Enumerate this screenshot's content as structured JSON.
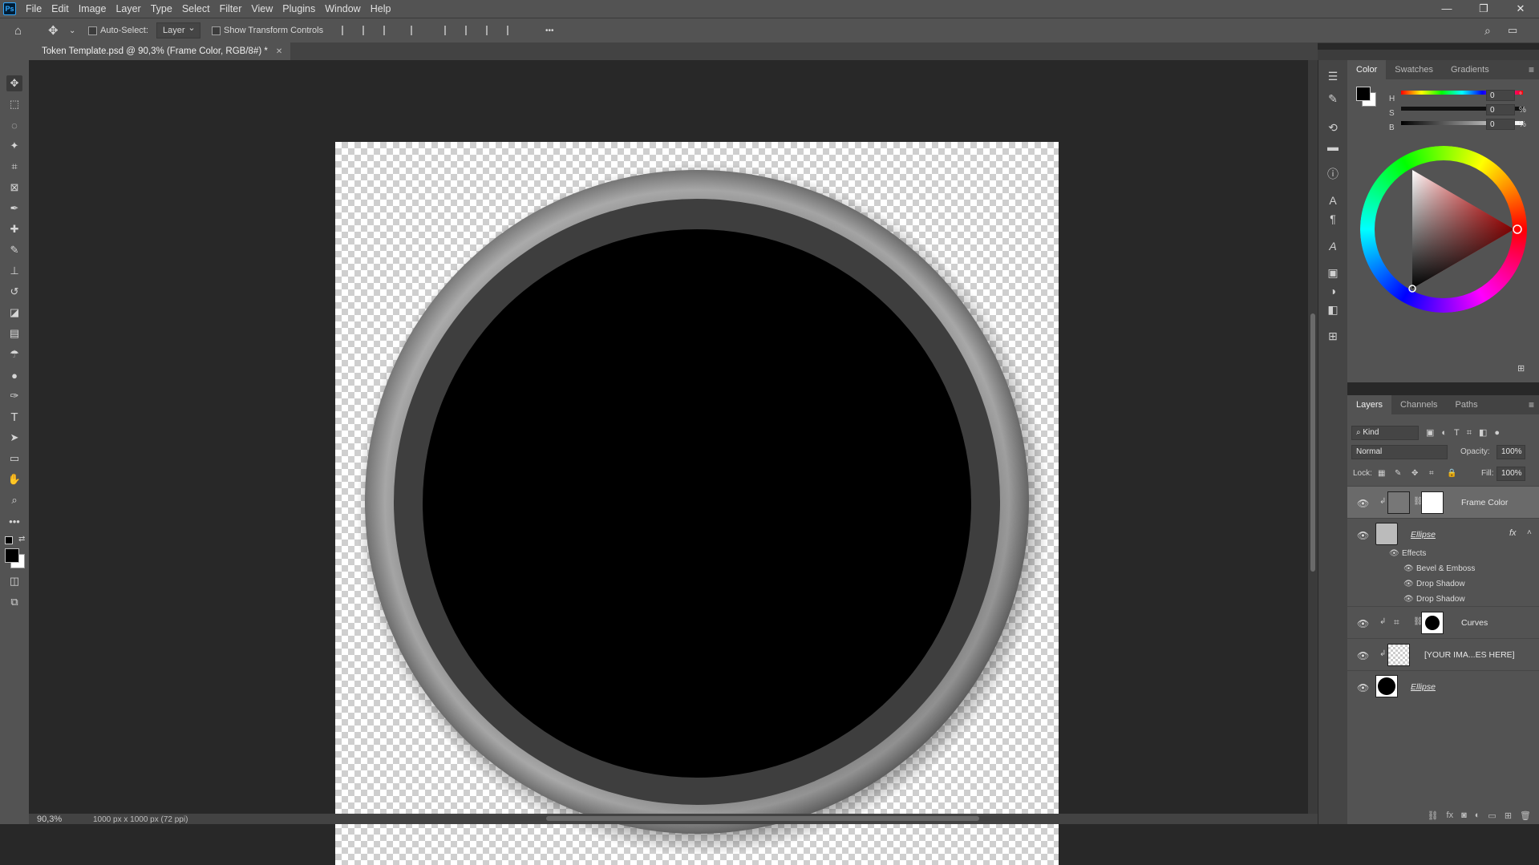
{
  "app": {
    "logo": "Ps"
  },
  "menu": [
    "File",
    "Edit",
    "Image",
    "Layer",
    "Type",
    "Select",
    "Filter",
    "View",
    "Plugins",
    "Window",
    "Help"
  ],
  "window_controls": {
    "minimize": "—",
    "restore": "❐",
    "close": "✕"
  },
  "options": {
    "auto_select_label": "Auto-Select:",
    "auto_select_value": "Layer",
    "transform_label": "Show Transform Controls",
    "more": "•••"
  },
  "document": {
    "tab_title": "Token Template.psd @ 90,3% (Frame Color, RGB/8#) *",
    "close": "✕"
  },
  "status": {
    "zoom": "90,3%",
    "size": "1000 px x 1000 px (72 ppi)"
  },
  "color_panel": {
    "tabs": [
      "Color",
      "Swatches",
      "Gradients"
    ],
    "sliders": [
      {
        "label": "H",
        "value": "0",
        "unit": "°"
      },
      {
        "label": "S",
        "value": "0",
        "unit": "%"
      },
      {
        "label": "B",
        "value": "0",
        "unit": "%"
      }
    ],
    "foreground": "#000000",
    "background": "#ffffff"
  },
  "layers_panel": {
    "tabs": [
      "Layers",
      "Channels",
      "Paths"
    ],
    "filter_kind": "Kind",
    "blend_mode": "Normal",
    "opacity_label": "Opacity:",
    "opacity_value": "100%",
    "lock_label": "Lock:",
    "fill_label": "Fill:",
    "fill_value": "100%",
    "layers": [
      {
        "name": "Frame Color",
        "selected": true
      },
      {
        "name": "Ellipse",
        "fx": "fx"
      },
      {
        "name": "Curves"
      },
      {
        "name": "[YOUR IMA...ES HERE]"
      },
      {
        "name": "Ellipse"
      }
    ],
    "effects_label": "Effects",
    "effects": [
      "Bevel & Emboss",
      "Drop Shadow",
      "Drop Shadow"
    ]
  }
}
